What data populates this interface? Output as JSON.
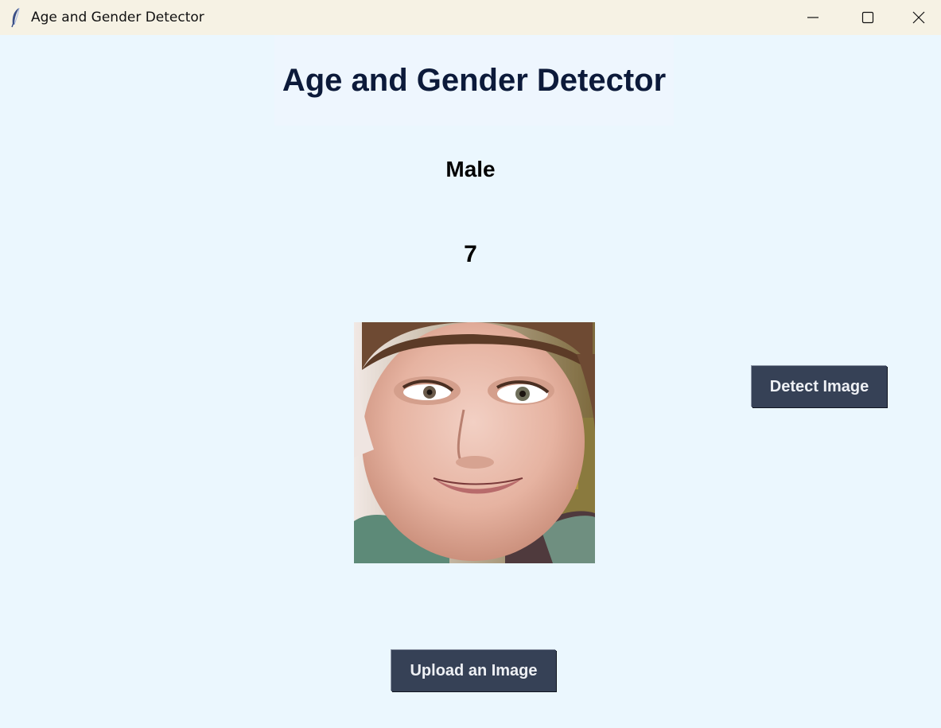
{
  "window": {
    "title": "Age and Gender Detector",
    "app_icon": "feather-icon",
    "controls": [
      "minimize-icon",
      "maximize-icon",
      "close-icon"
    ]
  },
  "main": {
    "heading": "Age and Gender Detector",
    "gender_result": "Male",
    "age_result": "7",
    "preview_image": "face-photo",
    "detect_button_label": "Detect Image",
    "upload_button_label": "Upload an Image"
  },
  "colors": {
    "background": "#ebf7fe",
    "titlebar": "#f6f2e4",
    "heading_text": "#0c1a3a",
    "button_bg": "#364156",
    "button_text": "#eef0f4"
  }
}
